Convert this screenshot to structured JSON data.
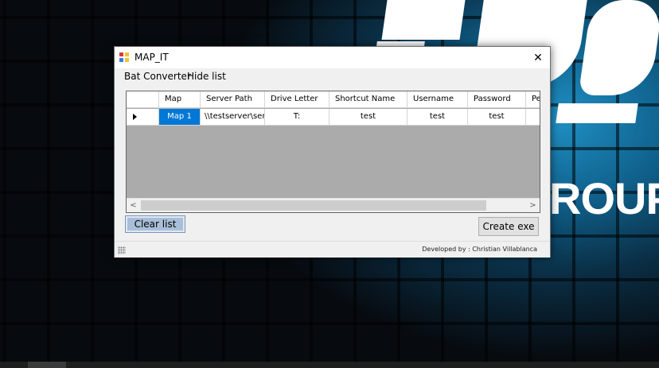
{
  "window": {
    "title": "MAP_IT",
    "close_glyph": "✕"
  },
  "menu": {
    "items": [
      {
        "label": "Bat Converter"
      },
      {
        "label": "Hide list"
      }
    ]
  },
  "grid": {
    "columns": [
      "Map",
      "Server Path",
      "Drive Letter",
      "Shortcut Name",
      "Username",
      "Password",
      "Pe"
    ],
    "rows": [
      {
        "map": "Map 1",
        "server_path": "\\\\testserver\\ser...",
        "drive_letter": "T:",
        "shortcut_name": "test",
        "username": "test",
        "password": "test",
        "extra": ""
      }
    ],
    "scroll_left_glyph": "<",
    "scroll_right_glyph": ">"
  },
  "buttons": {
    "clear": "Clear list",
    "create": "Create exe"
  },
  "status": {
    "developer": "Developed by : Christian Villablanca"
  },
  "wallpaper": {
    "logo_text": "ROUP"
  },
  "colors": {
    "selection": "#0078d7",
    "grid_background": "#ababab",
    "wallpaper_accent": "#1f90c4"
  },
  "icons": [
    "app-icon",
    "close-icon",
    "row-pointer-icon",
    "scroll-left-icon",
    "scroll-right-icon",
    "size-grip-icon"
  ]
}
